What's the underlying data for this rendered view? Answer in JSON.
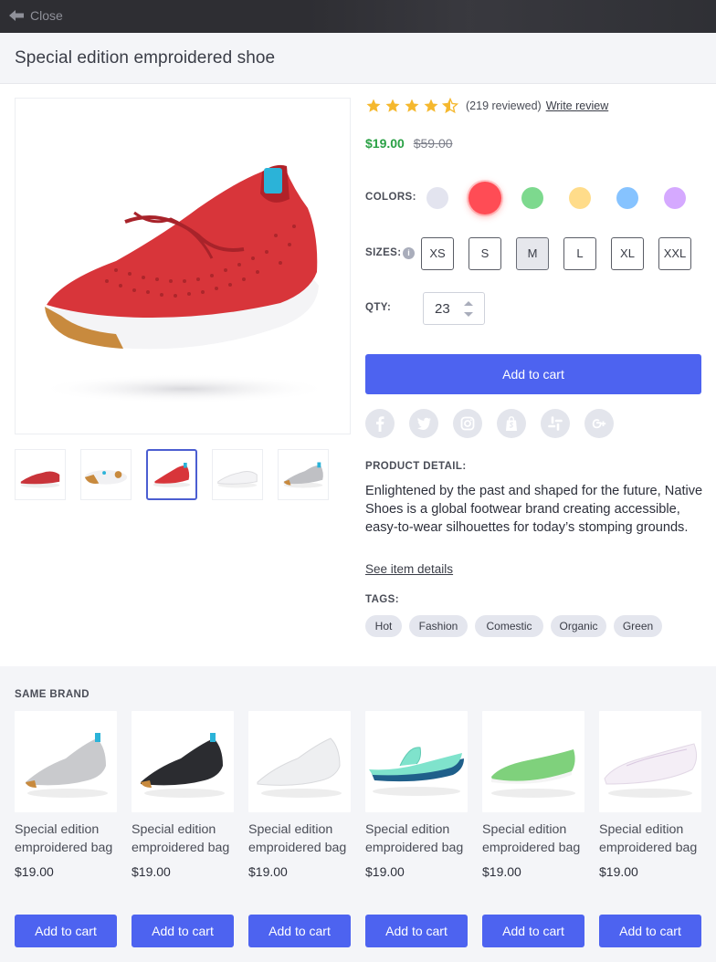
{
  "topbar": {
    "close_label": "Close"
  },
  "product": {
    "title": "Special edition emproidered shoe",
    "rating": 4.5,
    "review_count": "(219 reviewed)",
    "write_review": "Write review",
    "price": "$19.00",
    "old_price": "$59.00",
    "colors_label": "COLORS:",
    "colors": [
      "#e3e4ef",
      "#ff4c55",
      "#7dd98e",
      "#ffdc8a",
      "#86c3ff",
      "#d5a9ff"
    ],
    "selected_color_index": 1,
    "sizes_label": "SIZES:",
    "sizes": [
      "XS",
      "S",
      "M",
      "L",
      "XL",
      "XXL"
    ],
    "selected_size": "M",
    "qty_label": "QTY:",
    "qty_value": "23",
    "add_to_cart": "Add to cart",
    "social_icons": [
      "facebook-icon",
      "twitter-icon",
      "instagram-icon",
      "shopify-icon",
      "slack-icon",
      "google-plus-icon"
    ],
    "detail_label": "PRODUCT DETAIL:",
    "detail_text": "Enlightened by the past and shaped for the future, Native Shoes is a global footwear brand creating accessible, easy-to-wear silhouettes for today’s stomping grounds.",
    "see_details": "See item details",
    "tags_label": "TAGS:",
    "tags": [
      "Hot",
      "Fashion",
      "Comestic",
      "Organic",
      "Green"
    ],
    "thumbnails": [
      "red-shoe-side",
      "white-sole",
      "red-shoe-front",
      "white-shoe",
      "grey-shoe"
    ],
    "active_thumbnail_index": 2
  },
  "same_brand": {
    "label": "SAME BRAND",
    "items": [
      {
        "name": "Special edition emproidered bag",
        "price": "$19.00",
        "button": "Add to cart",
        "color": "#c9cacd"
      },
      {
        "name": "Special edition emproidered bag",
        "price": "$19.00",
        "button": "Add to cart",
        "color": "#2b2c30"
      },
      {
        "name": "Special edition emproidered bag",
        "price": "$19.00",
        "button": "Add to cart",
        "color": "#eeeff1"
      },
      {
        "name": "Special edition emproidered bag",
        "price": "$19.00",
        "button": "Add to cart",
        "color": "#7fe3cc"
      },
      {
        "name": "Special edition emproidered bag",
        "price": "$19.00",
        "button": "Add to cart",
        "color": "#7fd17c"
      },
      {
        "name": "Special edition emproidered bag",
        "price": "$19.00",
        "button": "Add to cart",
        "color": "#f4eef6"
      }
    ]
  }
}
